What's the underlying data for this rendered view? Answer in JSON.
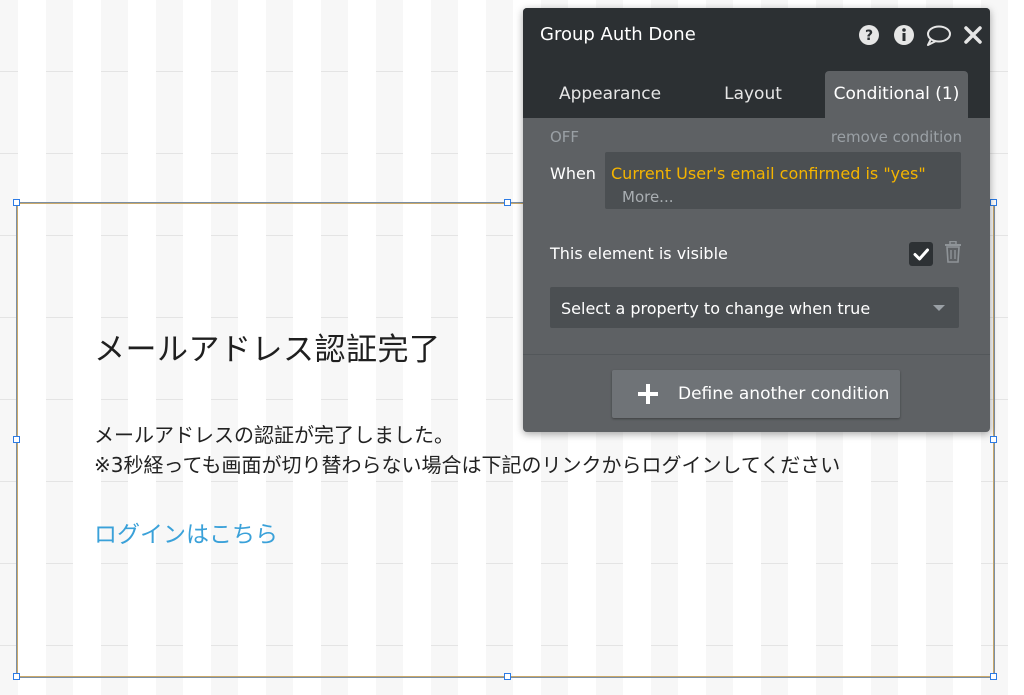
{
  "canvas": {
    "title": "メールアドレス認証完了",
    "body_line1": "メールアドレスの認証が完了しました。",
    "body_line2": "※3秒経っても画面が切り替わらない場合は下記のリンクからログインしてください",
    "login_link": "ログインはこちら",
    "link_color": "#3aa1d9"
  },
  "editor": {
    "title": "Group Auth Done",
    "header_icons": [
      "help-icon",
      "info-icon",
      "comment-icon",
      "close-icon"
    ],
    "tabs": [
      {
        "label": "Appearance",
        "active": false
      },
      {
        "label": "Layout",
        "active": false
      },
      {
        "label": "Conditional (1)",
        "active": true
      }
    ],
    "condition": {
      "status": "OFF",
      "remove_label": "remove condition",
      "when_label": "When",
      "expression": "Current User's email confirmed is \"yes\"",
      "more_label": "More...",
      "property_label": "This element is visible",
      "property_checked": true,
      "select_placeholder": "Select a property to change when true"
    },
    "add_button_label": "Define another condition",
    "colors": {
      "header_bg": "#2c3033",
      "panel_bg": "#5e6164",
      "expression_text": "#f4b400"
    }
  }
}
